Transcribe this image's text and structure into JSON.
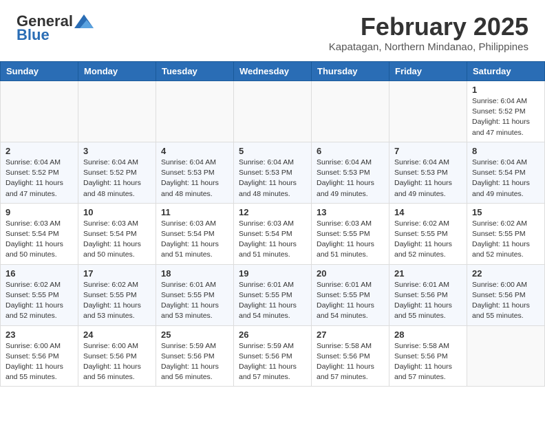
{
  "header": {
    "logo_general": "General",
    "logo_blue": "Blue",
    "month_year": "February 2025",
    "location": "Kapatagan, Northern Mindanao, Philippines"
  },
  "weekdays": [
    "Sunday",
    "Monday",
    "Tuesday",
    "Wednesday",
    "Thursday",
    "Friday",
    "Saturday"
  ],
  "weeks": [
    [
      {
        "day": "",
        "info": ""
      },
      {
        "day": "",
        "info": ""
      },
      {
        "day": "",
        "info": ""
      },
      {
        "day": "",
        "info": ""
      },
      {
        "day": "",
        "info": ""
      },
      {
        "day": "",
        "info": ""
      },
      {
        "day": "1",
        "info": "Sunrise: 6:04 AM\nSunset: 5:52 PM\nDaylight: 11 hours and 47 minutes."
      }
    ],
    [
      {
        "day": "2",
        "info": "Sunrise: 6:04 AM\nSunset: 5:52 PM\nDaylight: 11 hours and 47 minutes."
      },
      {
        "day": "3",
        "info": "Sunrise: 6:04 AM\nSunset: 5:52 PM\nDaylight: 11 hours and 48 minutes."
      },
      {
        "day": "4",
        "info": "Sunrise: 6:04 AM\nSunset: 5:53 PM\nDaylight: 11 hours and 48 minutes."
      },
      {
        "day": "5",
        "info": "Sunrise: 6:04 AM\nSunset: 5:53 PM\nDaylight: 11 hours and 48 minutes."
      },
      {
        "day": "6",
        "info": "Sunrise: 6:04 AM\nSunset: 5:53 PM\nDaylight: 11 hours and 49 minutes."
      },
      {
        "day": "7",
        "info": "Sunrise: 6:04 AM\nSunset: 5:53 PM\nDaylight: 11 hours and 49 minutes."
      },
      {
        "day": "8",
        "info": "Sunrise: 6:04 AM\nSunset: 5:54 PM\nDaylight: 11 hours and 49 minutes."
      }
    ],
    [
      {
        "day": "9",
        "info": "Sunrise: 6:03 AM\nSunset: 5:54 PM\nDaylight: 11 hours and 50 minutes."
      },
      {
        "day": "10",
        "info": "Sunrise: 6:03 AM\nSunset: 5:54 PM\nDaylight: 11 hours and 50 minutes."
      },
      {
        "day": "11",
        "info": "Sunrise: 6:03 AM\nSunset: 5:54 PM\nDaylight: 11 hours and 51 minutes."
      },
      {
        "day": "12",
        "info": "Sunrise: 6:03 AM\nSunset: 5:54 PM\nDaylight: 11 hours and 51 minutes."
      },
      {
        "day": "13",
        "info": "Sunrise: 6:03 AM\nSunset: 5:55 PM\nDaylight: 11 hours and 51 minutes."
      },
      {
        "day": "14",
        "info": "Sunrise: 6:02 AM\nSunset: 5:55 PM\nDaylight: 11 hours and 52 minutes."
      },
      {
        "day": "15",
        "info": "Sunrise: 6:02 AM\nSunset: 5:55 PM\nDaylight: 11 hours and 52 minutes."
      }
    ],
    [
      {
        "day": "16",
        "info": "Sunrise: 6:02 AM\nSunset: 5:55 PM\nDaylight: 11 hours and 52 minutes."
      },
      {
        "day": "17",
        "info": "Sunrise: 6:02 AM\nSunset: 5:55 PM\nDaylight: 11 hours and 53 minutes."
      },
      {
        "day": "18",
        "info": "Sunrise: 6:01 AM\nSunset: 5:55 PM\nDaylight: 11 hours and 53 minutes."
      },
      {
        "day": "19",
        "info": "Sunrise: 6:01 AM\nSunset: 5:55 PM\nDaylight: 11 hours and 54 minutes."
      },
      {
        "day": "20",
        "info": "Sunrise: 6:01 AM\nSunset: 5:55 PM\nDaylight: 11 hours and 54 minutes."
      },
      {
        "day": "21",
        "info": "Sunrise: 6:01 AM\nSunset: 5:56 PM\nDaylight: 11 hours and 55 minutes."
      },
      {
        "day": "22",
        "info": "Sunrise: 6:00 AM\nSunset: 5:56 PM\nDaylight: 11 hours and 55 minutes."
      }
    ],
    [
      {
        "day": "23",
        "info": "Sunrise: 6:00 AM\nSunset: 5:56 PM\nDaylight: 11 hours and 55 minutes."
      },
      {
        "day": "24",
        "info": "Sunrise: 6:00 AM\nSunset: 5:56 PM\nDaylight: 11 hours and 56 minutes."
      },
      {
        "day": "25",
        "info": "Sunrise: 5:59 AM\nSunset: 5:56 PM\nDaylight: 11 hours and 56 minutes."
      },
      {
        "day": "26",
        "info": "Sunrise: 5:59 AM\nSunset: 5:56 PM\nDaylight: 11 hours and 57 minutes."
      },
      {
        "day": "27",
        "info": "Sunrise: 5:58 AM\nSunset: 5:56 PM\nDaylight: 11 hours and 57 minutes."
      },
      {
        "day": "28",
        "info": "Sunrise: 5:58 AM\nSunset: 5:56 PM\nDaylight: 11 hours and 57 minutes."
      },
      {
        "day": "",
        "info": ""
      }
    ]
  ]
}
